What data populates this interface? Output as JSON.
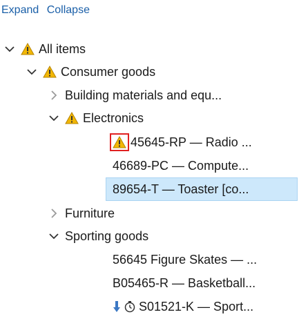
{
  "toolbar": {
    "expand": "Expand",
    "collapse": "Collapse"
  },
  "tree": {
    "all_items": "All items",
    "consumer_goods": "Consumer goods",
    "building_materials": "Building materials and equ...",
    "electronics": "Electronics",
    "radio": "45645-RP — Radio ...",
    "computer": "46689-PC — Compute...",
    "toaster": "89654-T — Toaster [co...",
    "furniture": "Furniture",
    "sporting_goods": "Sporting goods",
    "skates": "56645 Figure Skates — ...",
    "basketball": "B05465-R — Basketball...",
    "sport": "S01521-K — Sport..."
  },
  "colors": {
    "link": "#1a5fa8",
    "selection": "#cde8fb",
    "warning": "#f2b705",
    "highlight_box": "#e02020"
  }
}
